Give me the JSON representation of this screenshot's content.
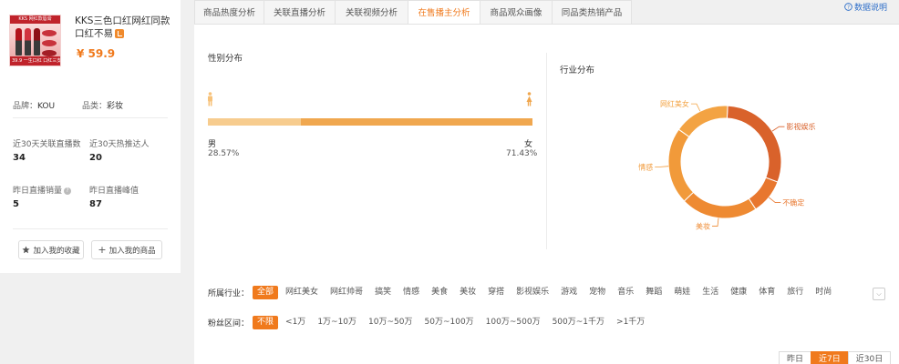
{
  "product": {
    "title": "KKS三色口红网红同款口红不易",
    "thumb_banner": "KKS 网红款唇膏",
    "thumb_footer": "39.9 一生口红 口红三支",
    "price": "¥ 59.9",
    "brand_label": "品牌：",
    "brand": "KOU",
    "category_label": "品类：",
    "category": "彩妆",
    "stats": [
      {
        "label": "近30天关联直播数",
        "value": "34"
      },
      {
        "label": "近30天热推达人",
        "value": "20"
      },
      {
        "label": "昨日直播销量",
        "value": "5"
      },
      {
        "label": "昨日直播峰值",
        "value": "87"
      }
    ],
    "btn_favorite": "加入我的收藏",
    "btn_goods": "加入我的商品"
  },
  "tabs": [
    "商品热度分析",
    "关联直播分析",
    "关联视频分析",
    "在售播主分析",
    "商品观众画像",
    "同品类热销产品"
  ],
  "active_tab": 3,
  "help_link": "数据说明",
  "gender": {
    "title": "性别分布",
    "male_label": "男",
    "female_label": "女",
    "male_pct": "28.57%",
    "female_pct": "71.43%",
    "male_value": 28.57
  },
  "industry": {
    "title": "行业分布",
    "slices": [
      {
        "name": "影视娱乐",
        "value": 30,
        "color": "#d9622b"
      },
      {
        "name": "不确定",
        "value": 10,
        "color": "#e8772e"
      },
      {
        "name": "美妆",
        "value": 22,
        "color": "#ee8a32"
      },
      {
        "name": "情感",
        "value": 22,
        "color": "#f19a3a"
      },
      {
        "name": "网红美女",
        "value": 16,
        "color": "#f3a343"
      }
    ]
  },
  "filters": {
    "industry_label": "所属行业：",
    "industry_options": [
      "全部",
      "网红美女",
      "网红帅哥",
      "搞笑",
      "情感",
      "美食",
      "美妆",
      "穿搭",
      "影视娱乐",
      "游戏",
      "宠物",
      "音乐",
      "舞蹈",
      "萌娃",
      "生活",
      "健康",
      "体育",
      "旅行",
      "时尚"
    ],
    "industry_selected": 0,
    "fans_label": "粉丝区间：",
    "fans_options": [
      "不限",
      "<1万",
      "1万~10万",
      "10万~50万",
      "50万~100万",
      "100万~500万",
      "500万~1千万",
      ">1千万"
    ],
    "fans_selected": 0
  },
  "date_range": {
    "options": [
      "昨日",
      "近7日",
      "近30日"
    ],
    "selected": 1
  },
  "colors": {
    "accent": "#f07a1d",
    "link": "#2f6fc9"
  }
}
